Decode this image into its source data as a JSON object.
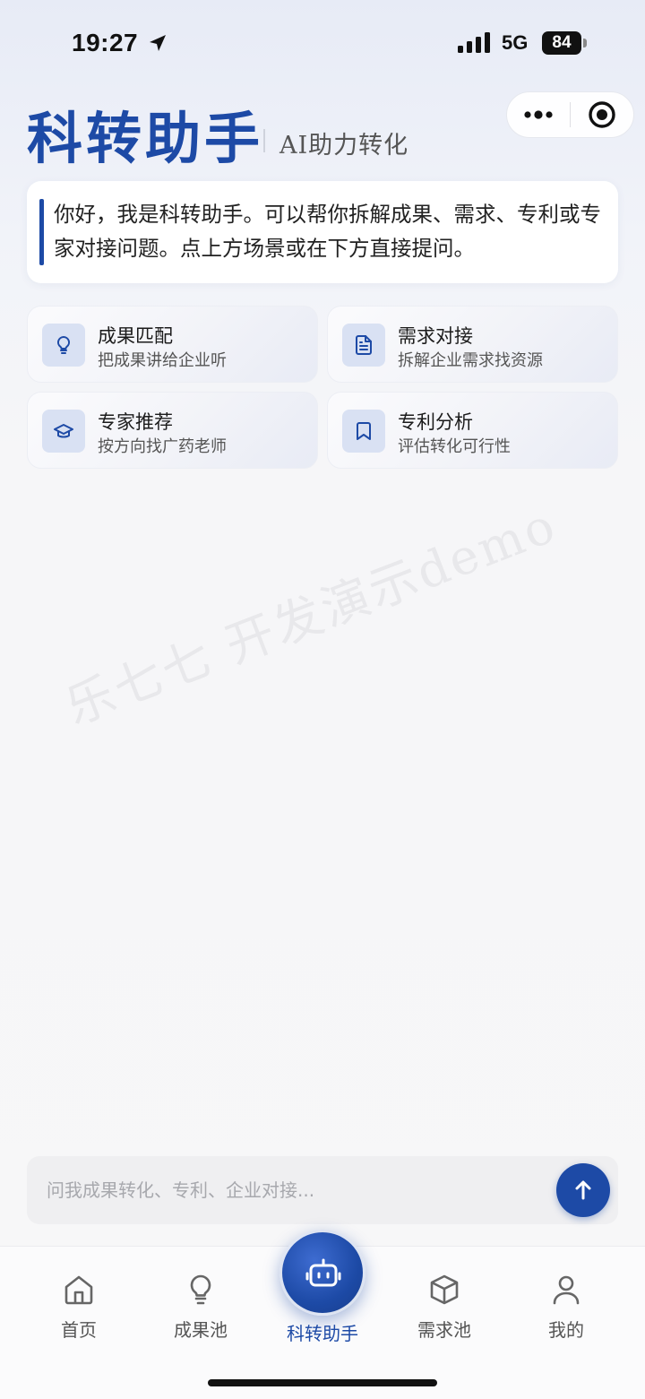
{
  "status_bar": {
    "time": "19:27",
    "network": "5G",
    "battery": "84"
  },
  "header": {
    "title": "科转助手",
    "subtitle": "AI助力转化"
  },
  "intro": {
    "text": "你好，我是科转助手。可以帮你拆解成果、需求、专利或专家对接问题。点上方场景或在下方直接提问。"
  },
  "scenes": [
    {
      "title": "成果匹配",
      "desc": "把成果讲给企业听",
      "icon": "lightbulb-icon"
    },
    {
      "title": "需求对接",
      "desc": "拆解企业需求找资源",
      "icon": "document-icon"
    },
    {
      "title": "专家推荐",
      "desc": "按方向找广药老师",
      "icon": "graduation-cap-icon"
    },
    {
      "title": "专利分析",
      "desc": "评估转化可行性",
      "icon": "bookmark-icon"
    }
  ],
  "watermark": "乐七七 开发演示demo",
  "input": {
    "placeholder": "问我成果转化、专利、企业对接...",
    "value": ""
  },
  "tabs": [
    {
      "label": "首页",
      "icon": "home-icon"
    },
    {
      "label": "成果池",
      "icon": "lightbulb-icon"
    },
    {
      "label": "科转助手",
      "icon": "robot-icon",
      "active": true
    },
    {
      "label": "需求池",
      "icon": "box-icon"
    },
    {
      "label": "我的",
      "icon": "user-icon"
    }
  ],
  "colors": {
    "accent": "#1d4aa6",
    "icon_bg": "#d9e1f3",
    "background": "#f7f7f8"
  }
}
